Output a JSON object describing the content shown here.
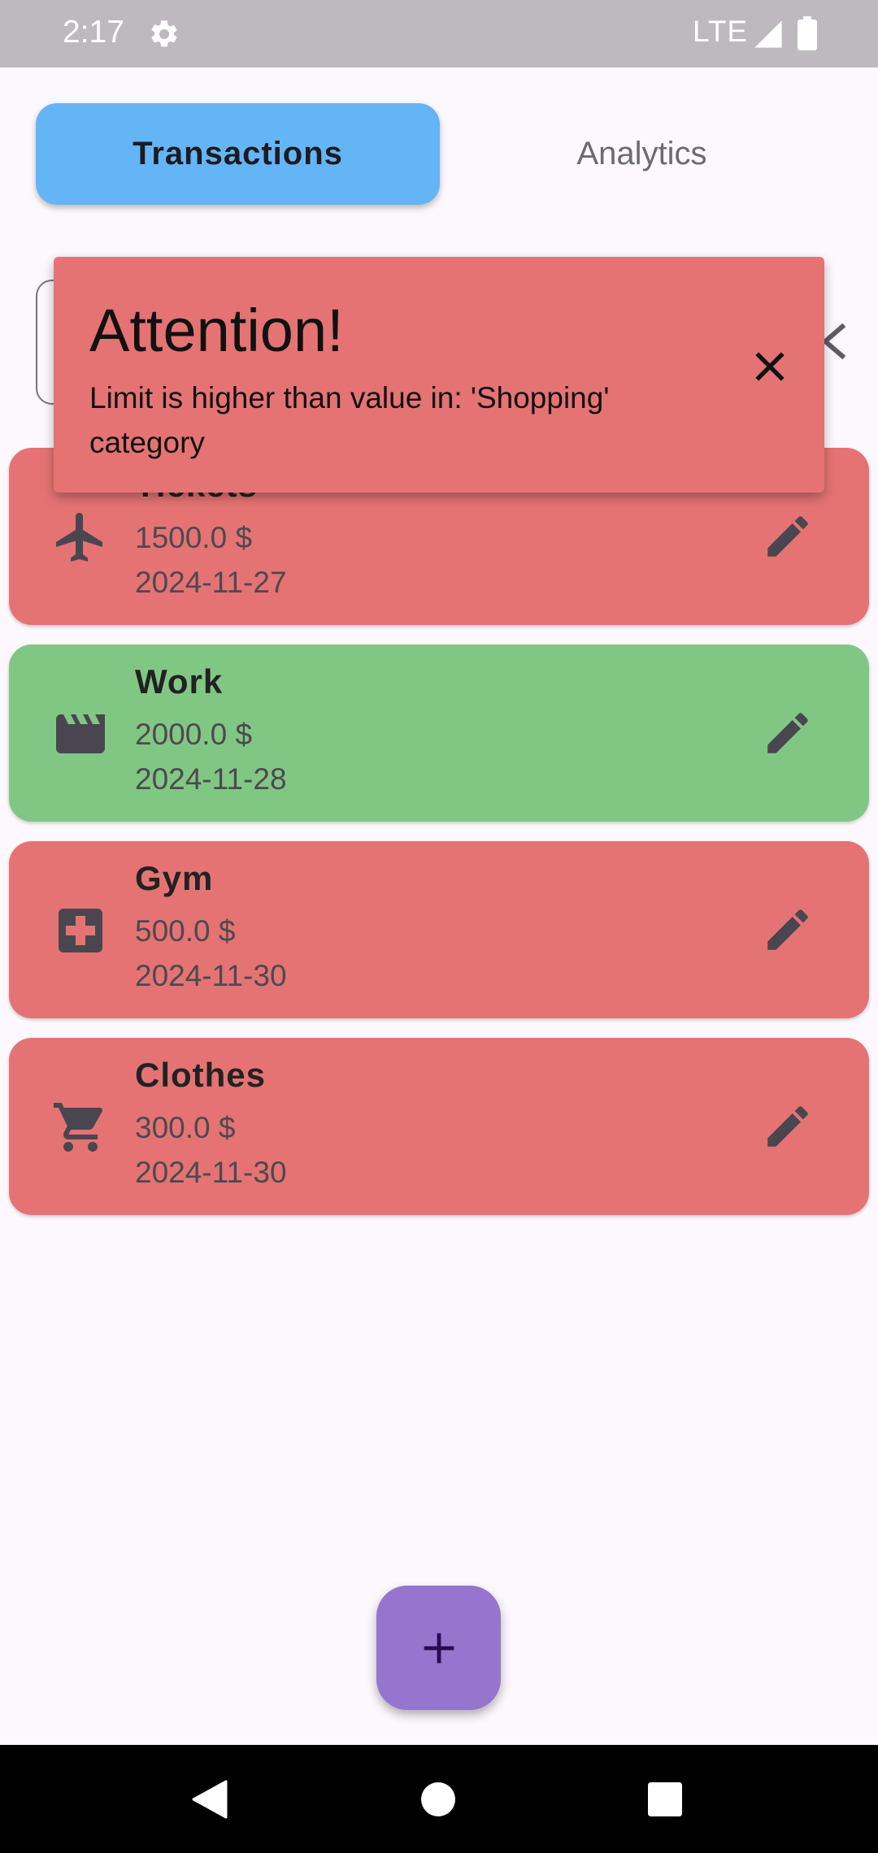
{
  "status_bar": {
    "time": "2:17",
    "network": "LTE"
  },
  "tabs": [
    {
      "label": "Transactions",
      "active": true
    },
    {
      "label": "Analytics",
      "active": false
    }
  ],
  "colors": {
    "expense": "#E57373",
    "income": "#81C784",
    "tab_active": "#64B5F6",
    "fab": "#9575CD"
  },
  "transactions": [
    {
      "title": "Tickets",
      "amount": "1500.0 $",
      "date": "2024-11-27",
      "icon": "airplane-icon",
      "type": "expense"
    },
    {
      "title": "Work",
      "amount": "2000.0 $",
      "date": "2024-11-28",
      "icon": "clapperboard-icon",
      "type": "income"
    },
    {
      "title": "Gym",
      "amount": "500.0 $",
      "date": "2024-11-30",
      "icon": "medical-cross-icon",
      "type": "expense"
    },
    {
      "title": "Clothes",
      "amount": "300.0 $",
      "date": "2024-11-30",
      "icon": "shopping-cart-icon",
      "type": "expense"
    }
  ],
  "snackbar": {
    "title": "Attention!",
    "message": "Limit is higher than value in: 'Shopping' category"
  },
  "fab": {
    "icon": "plus-icon"
  }
}
